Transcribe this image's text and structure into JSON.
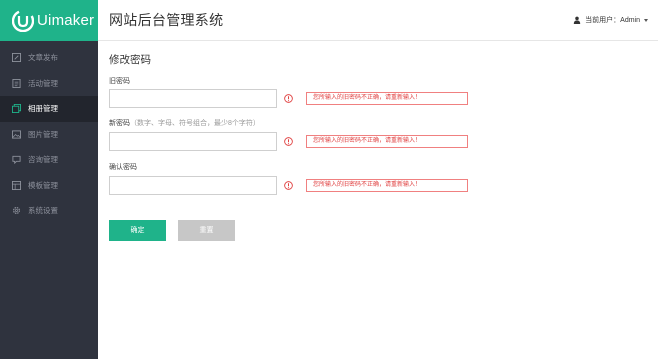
{
  "brand": {
    "logo_text": "Uimaker"
  },
  "header": {
    "title": "网站后台管理系统",
    "user_label": "当前用户：",
    "user_name": "Admin"
  },
  "sidebar": {
    "items": [
      {
        "label": "文章发布",
        "icon": "edit-icon",
        "active": false
      },
      {
        "label": "活动管理",
        "icon": "document-icon",
        "active": false
      },
      {
        "label": "相册管理",
        "icon": "album-icon",
        "active": true
      },
      {
        "label": "图片管理",
        "icon": "image-icon",
        "active": false
      },
      {
        "label": "咨询管理",
        "icon": "chat-icon",
        "active": false
      },
      {
        "label": "模板管理",
        "icon": "template-icon",
        "active": false
      },
      {
        "label": "系统设置",
        "icon": "gear-icon",
        "active": false
      }
    ]
  },
  "form": {
    "title": "修改密码",
    "old_password": {
      "label": "旧密码",
      "value": "",
      "error": "您所输入的旧密码不正确，请重新输入！"
    },
    "new_password": {
      "label": "新密码",
      "hint": "（数字、字母、符号组合，最少8个字符）",
      "value": "",
      "error": "您所输入的旧密码不正确，请重新输入！"
    },
    "confirm_password": {
      "label": "确认密码",
      "value": "",
      "error": "您所输入的旧密码不正确，请重新输入！"
    },
    "confirm_button": "确定",
    "reset_button": "重置"
  },
  "colors": {
    "accent": "#1fb38a",
    "sidebar_bg": "#2f333e",
    "sidebar_active": "#22252d",
    "error": "#e04040"
  }
}
